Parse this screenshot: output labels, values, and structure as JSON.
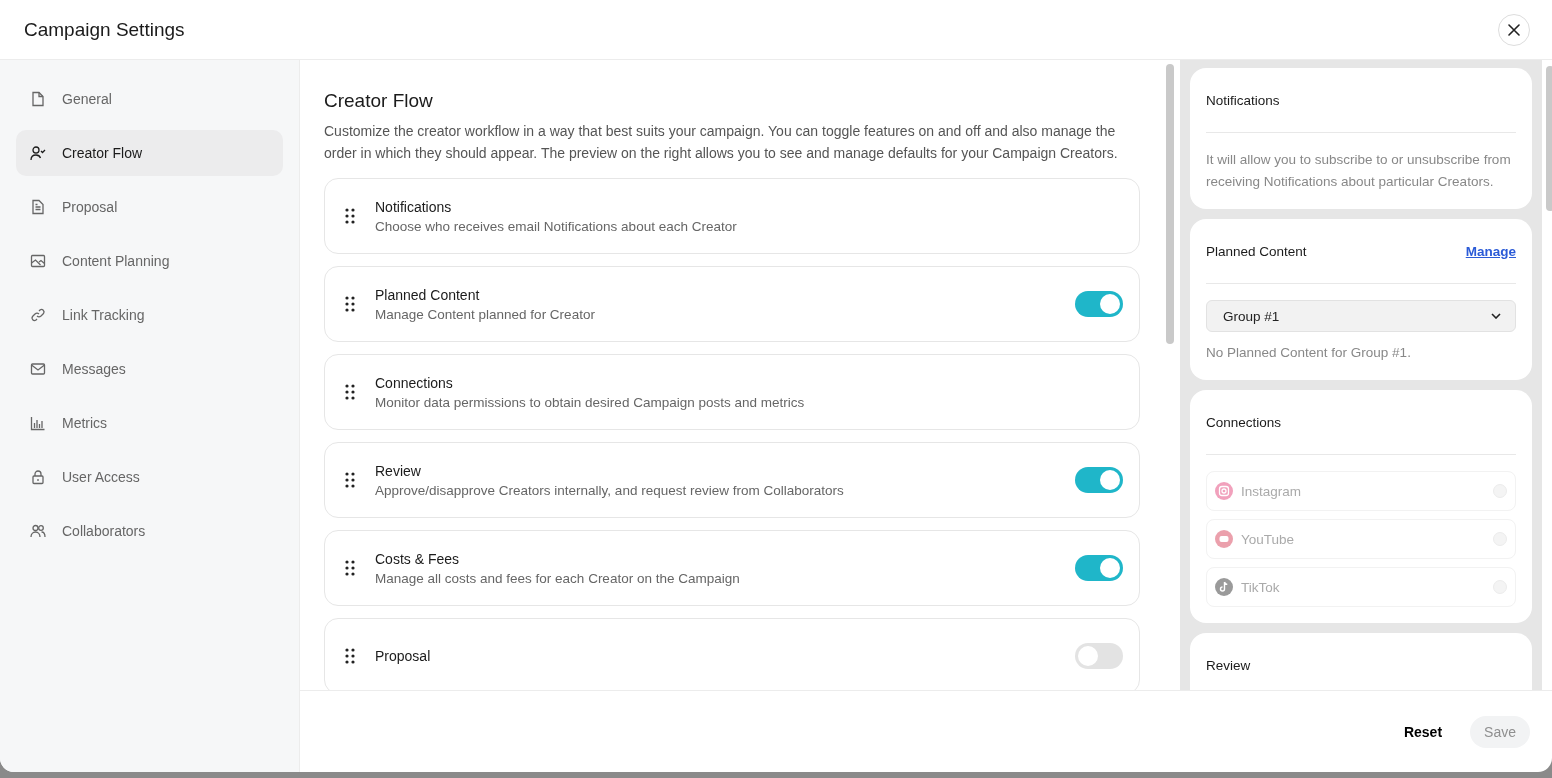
{
  "window": {
    "title": "Campaign Settings"
  },
  "sidebar": {
    "items": [
      {
        "label": "General",
        "selected": false
      },
      {
        "label": "Creator Flow",
        "selected": true
      },
      {
        "label": "Proposal",
        "selected": false
      },
      {
        "label": "Content Planning",
        "selected": false
      },
      {
        "label": "Link Tracking",
        "selected": false
      },
      {
        "label": "Messages",
        "selected": false
      },
      {
        "label": "Metrics",
        "selected": false
      },
      {
        "label": "User Access",
        "selected": false
      },
      {
        "label": "Collaborators",
        "selected": false
      }
    ]
  },
  "main": {
    "title": "Creator Flow",
    "description": "Customize the creator workflow in a way that best suits your campaign. You can toggle features on and off and also manage the order in which they should appear. The preview on the right allows you to see and manage defaults for your Campaign Creators.",
    "features": [
      {
        "kind": "fixed",
        "title": "Notifications",
        "description": "Choose who receives email Notifications about each Creator"
      },
      {
        "kind": "toggle",
        "title": "Planned Content",
        "description": "Manage Content planned for Creator",
        "on": true
      },
      {
        "kind": "fixed",
        "title": "Connections",
        "description": "Monitor data permissions to obtain desired Campaign posts and metrics"
      },
      {
        "kind": "toggle",
        "title": "Review",
        "description": "Approve/disapprove Creators internally, and request review from Collaborators",
        "on": true
      },
      {
        "kind": "toggle",
        "title": "Costs & Fees",
        "description": "Manage all costs and fees for each Creator on the Campaign",
        "on": true
      },
      {
        "kind": "toggle",
        "title": "Proposal",
        "on": false
      }
    ]
  },
  "preview": {
    "notifications": {
      "title": "Notifications",
      "text": "It will allow you to subscribe to or unsubscribe from receiving Notifications about particular Creators."
    },
    "planned_content": {
      "title": "Planned Content",
      "link": "Manage",
      "select": "Group #1",
      "empty_text": "No Planned Content for Group #1."
    },
    "connections": {
      "title": "Connections",
      "items": [
        {
          "kind": "instagram",
          "label": "Instagram",
          "disabled": true
        },
        {
          "kind": "youtube",
          "label": "YouTube",
          "disabled": true
        },
        {
          "kind": "tiktok",
          "label": "TikTok",
          "disabled": true
        }
      ]
    },
    "review": {
      "title": "Review"
    }
  },
  "footer": {
    "reset": "Reset",
    "save": "Save",
    "save_disabled": true
  }
}
